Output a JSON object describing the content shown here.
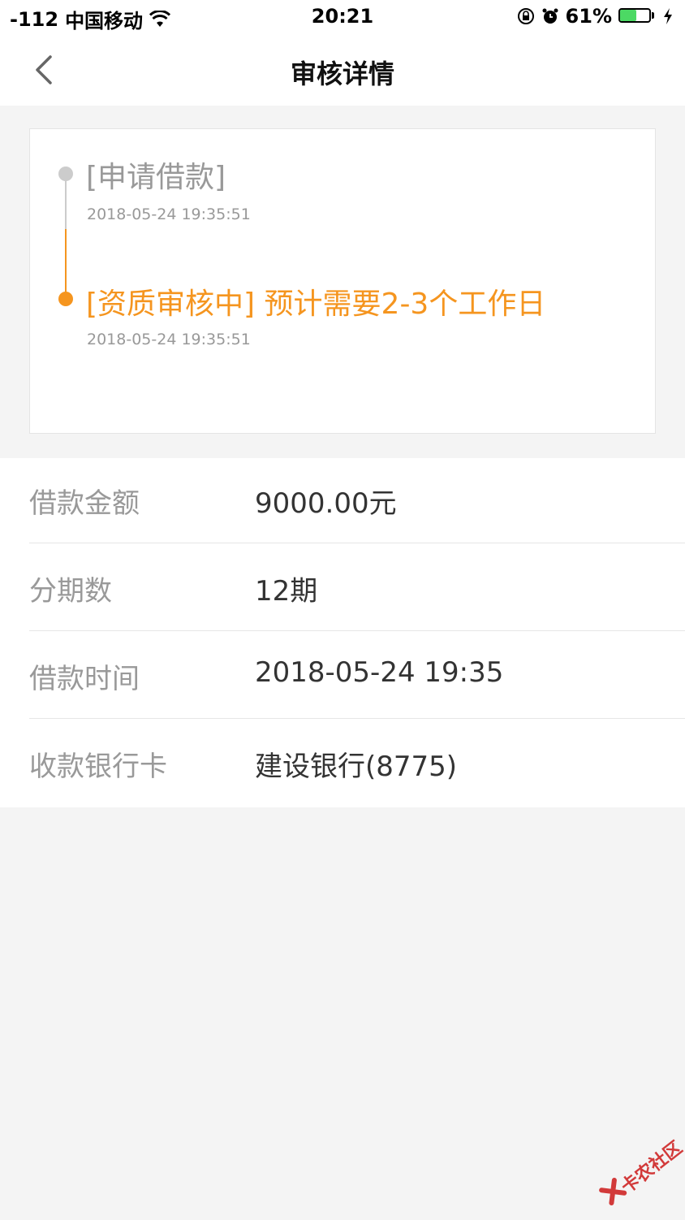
{
  "status_bar": {
    "signal": "-112",
    "carrier": "中国移动",
    "time": "20:21",
    "battery_percent": "61%",
    "battery_level": 0.61
  },
  "nav": {
    "title": "审核详情"
  },
  "timeline": [
    {
      "title": "[申请借款]",
      "time": "2018-05-24 19:35:51",
      "state": "done"
    },
    {
      "title": "[资质审核中] 预计需要2-3个工作日",
      "time": "2018-05-24 19:35:51",
      "state": "current"
    }
  ],
  "details": [
    {
      "label": "借款金额",
      "value": "9000.00元"
    },
    {
      "label": "分期数",
      "value": "12期"
    },
    {
      "label": "借款时间",
      "value": "2018-05-24 19:35"
    },
    {
      "label": "收款银行卡",
      "value": "建设银行(8775)"
    }
  ],
  "watermark": {
    "text": "卡农社区"
  },
  "colors": {
    "accent": "#f5951f",
    "muted": "#999999",
    "text": "#333333",
    "background": "#f4f4f4",
    "battery": "#4cd964"
  }
}
